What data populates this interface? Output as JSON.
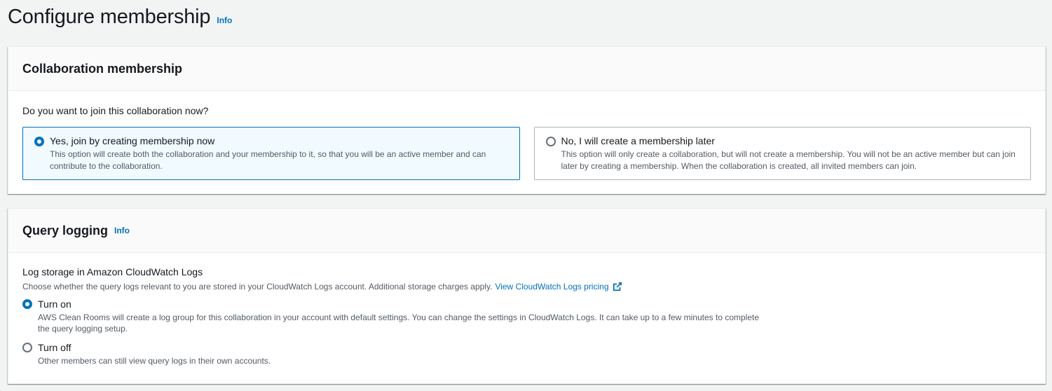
{
  "page": {
    "title": "Configure membership",
    "info_label": "Info"
  },
  "membership": {
    "title": "Collaboration membership",
    "question": "Do you want to join this collaboration now?",
    "options": [
      {
        "label": "Yes, join by creating membership now",
        "description": "This option will create both the collaboration and your membership to it, so that you will be an active member and can contribute to the collaboration.",
        "selected": true
      },
      {
        "label": "No, I will create a membership later",
        "description": "This option will only create a collaboration, but will not create a membership. You will not be an active member but can join later by creating a membership. When the collaboration is created, all invited members can join.",
        "selected": false
      }
    ]
  },
  "query_logging": {
    "title": "Query logging",
    "info_label": "Info",
    "field_label": "Log storage in Amazon CloudWatch Logs",
    "field_description": "Choose whether the query logs relevant to you are stored in your CloudWatch Logs account. Additional storage charges apply.",
    "pricing_link": "View CloudWatch Logs pricing",
    "options": [
      {
        "label": "Turn on",
        "description": "AWS Clean Rooms will create a log group for this collaboration in your account with default settings. You can change the settings in CloudWatch Logs. It can take up to a few minutes to complete the query logging setup.",
        "selected": true
      },
      {
        "label": "Turn off",
        "description": "Other members can still view query logs in their own accounts.",
        "selected": false
      }
    ]
  },
  "colors": {
    "accent": "#0073bb",
    "selected_tile_bg": "#f1faff",
    "page_bg": "#f2f3f3"
  },
  "icons": {
    "external_link": "external-link-icon"
  }
}
